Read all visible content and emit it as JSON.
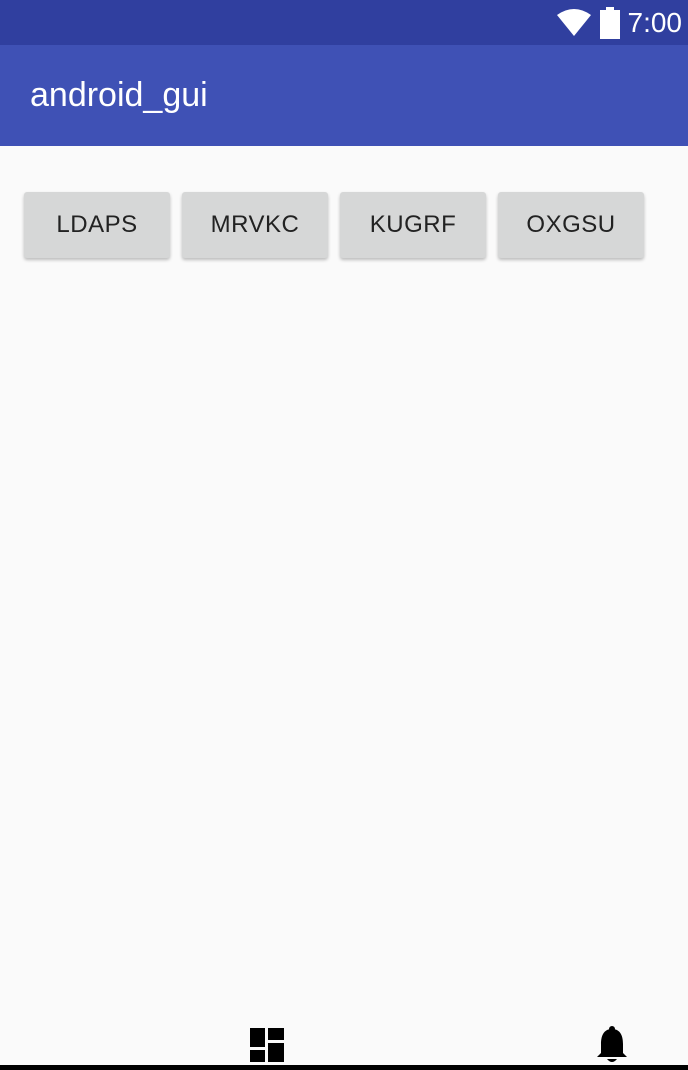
{
  "status_bar": {
    "time": "7:00",
    "icons": [
      "wifi-icon",
      "battery-icon"
    ],
    "background": "#303f9f"
  },
  "app_bar": {
    "title": "android_gui",
    "background": "#3f51b5"
  },
  "buttons": [
    {
      "label": "LDAPS"
    },
    {
      "label": "MRVKC"
    },
    {
      "label": "KUGRF"
    },
    {
      "label": "OXGSU"
    }
  ],
  "nav_bar": {
    "icons": [
      "dashboard-icon",
      "bell-icon"
    ]
  }
}
